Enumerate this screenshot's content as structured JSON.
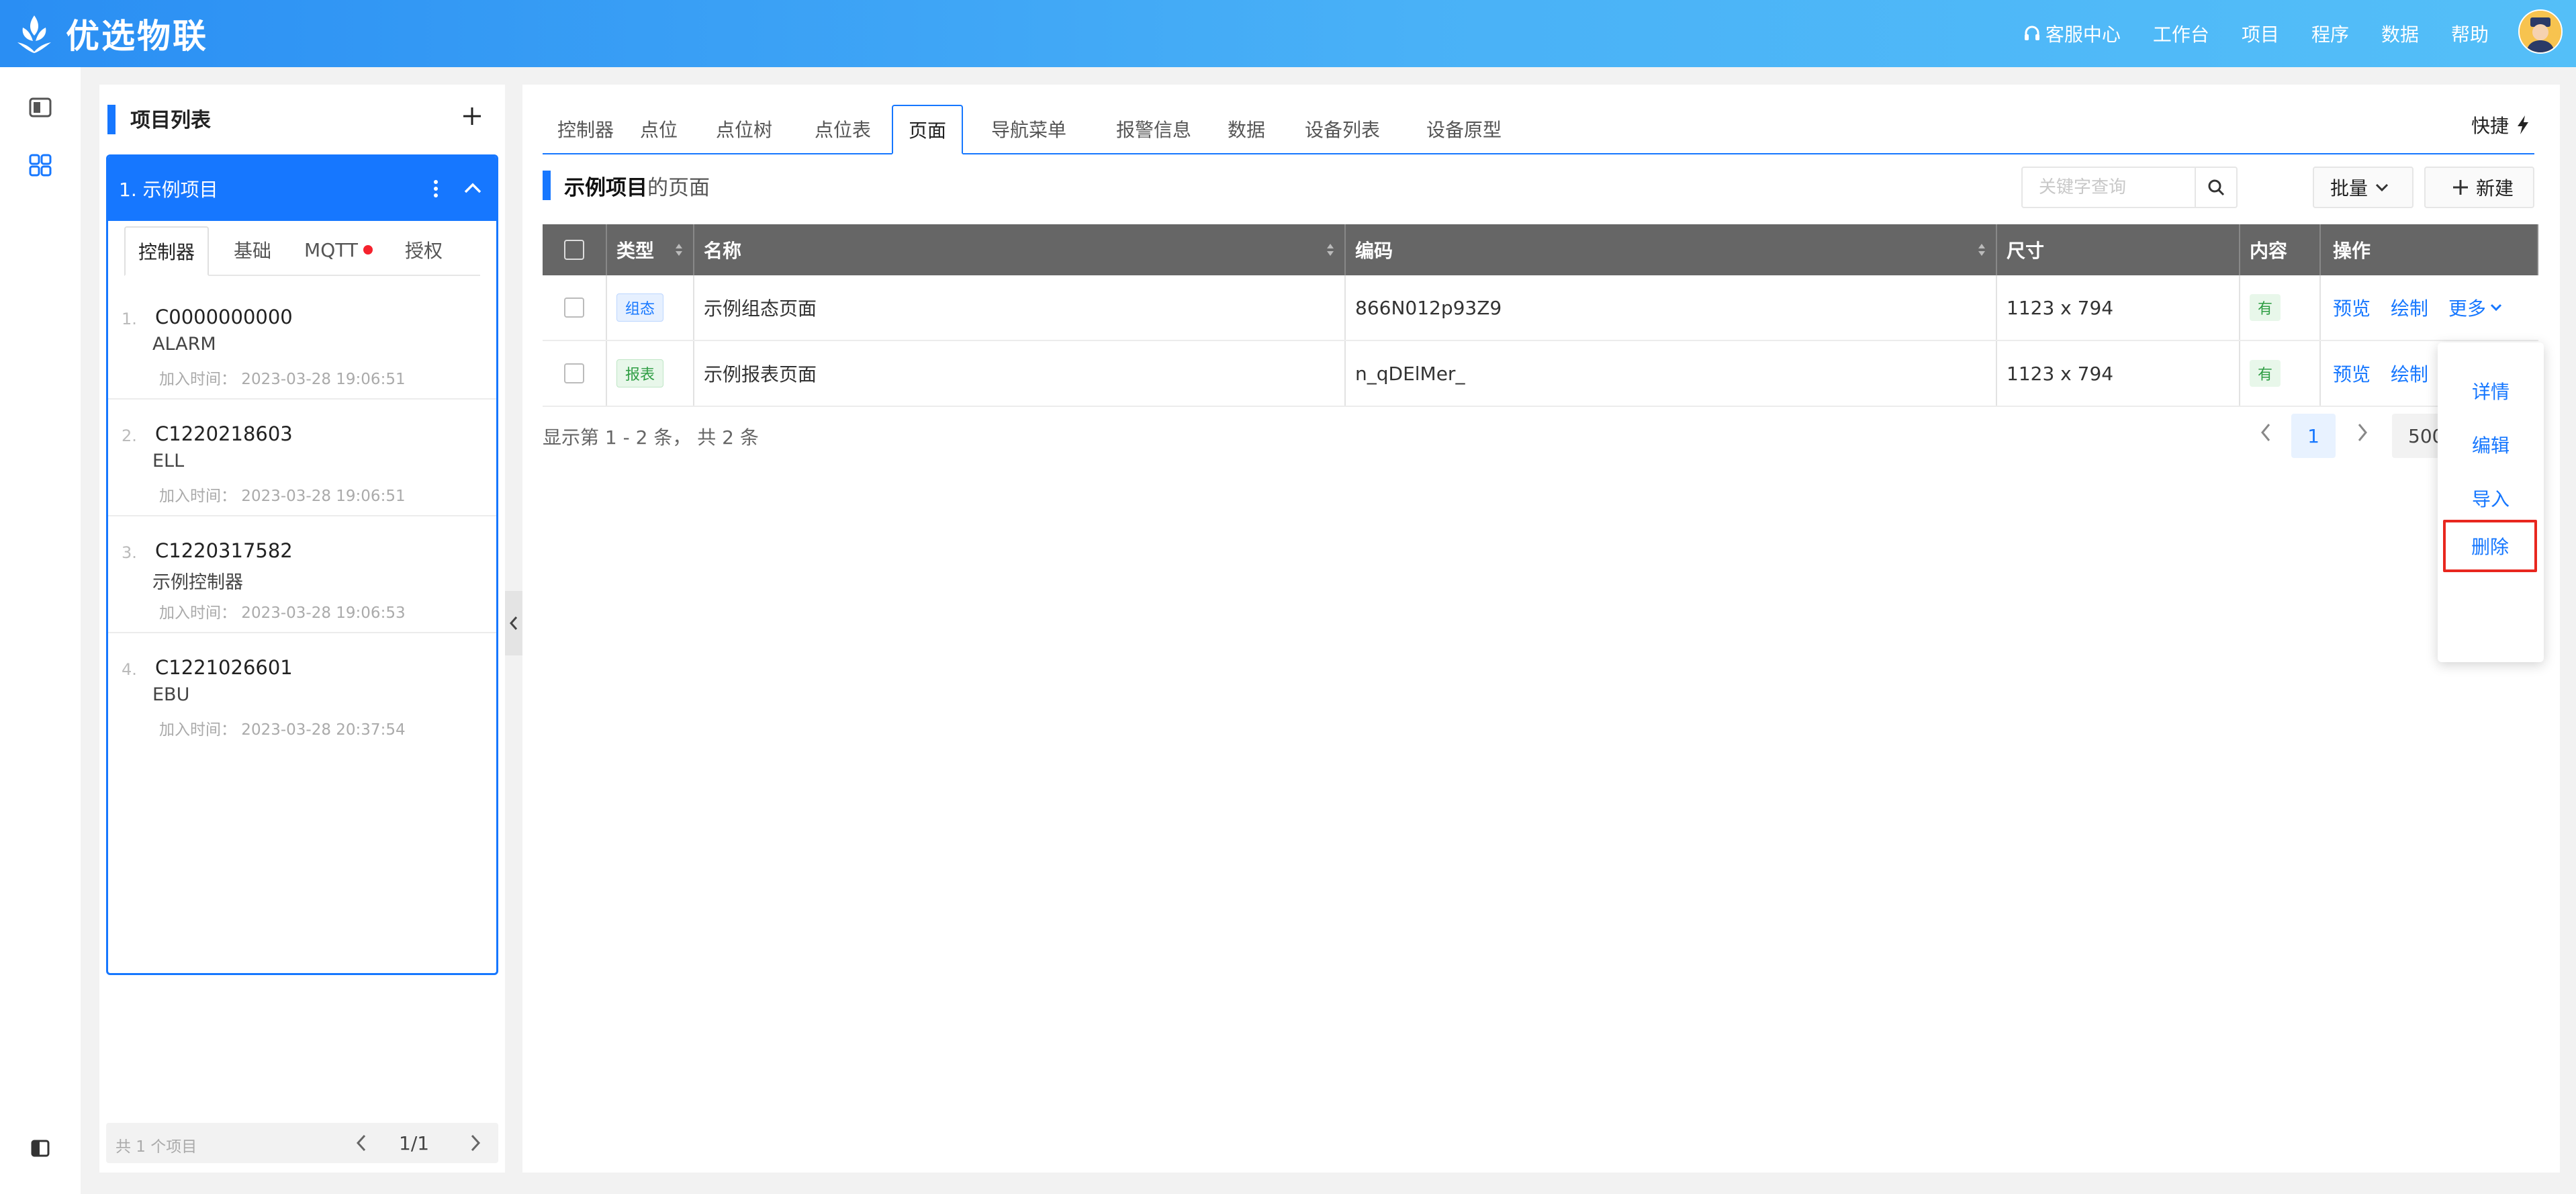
{
  "app": {
    "name": "优选物联"
  },
  "topnav": {
    "service": "客服中心",
    "items": [
      "工作台",
      "项目",
      "程序",
      "数据",
      "帮助"
    ]
  },
  "project_panel": {
    "title": "项目列表",
    "project_name": "1. 示例项目",
    "tabs": [
      "控制器",
      "基础",
      "MQTT",
      "授权"
    ],
    "controllers": [
      {
        "index": "1.",
        "code": "C0000000000",
        "name": "ALARM",
        "time": "加入时间： 2023-03-28 19:06:51"
      },
      {
        "index": "2.",
        "code": "C1220218603",
        "name": "ELL",
        "time": "加入时间： 2023-03-28 19:06:51"
      },
      {
        "index": "3.",
        "code": "C1220317582",
        "name": "示例控制器",
        "time": "加入时间： 2023-03-28 19:06:53"
      },
      {
        "index": "4.",
        "code": "C1221026601",
        "name": "EBU",
        "time": "加入时间： 2023-03-28 20:37:54"
      }
    ],
    "footer": {
      "count": "共 1 个项目",
      "page": "1/1"
    }
  },
  "main": {
    "tabs": [
      "控制器",
      "点位",
      "点位树",
      "点位表",
      "页面",
      "导航菜单",
      "报警信息",
      "数据",
      "设备列表",
      "设备原型"
    ],
    "active_tab": "页面",
    "quick": "快捷",
    "section_title_strong": "示例项目",
    "section_title_rest": "的页面",
    "search_placeholder": "关键字查询",
    "batch": "批量",
    "new": "新建",
    "table": {
      "headers": [
        "类型",
        "名称",
        "编码",
        "尺寸",
        "内容",
        "操作"
      ],
      "rows": [
        {
          "type": "组态",
          "name": "示例组态页面",
          "code": "866N012p93Z9",
          "size": "1123 x 794",
          "content": "有"
        },
        {
          "type": "报表",
          "name": "示例报表页面",
          "code": "n_qDElMer_",
          "size": "1123 x 794",
          "content": "有"
        }
      ],
      "ops": {
        "preview": "预览",
        "draw": "绘制",
        "more": "更多"
      }
    },
    "summary": "显示第 1 - 2 条， 共 2 条",
    "pager": {
      "current": "1",
      "size": "500"
    },
    "more_menu": [
      "详情",
      "编辑",
      "导入",
      "删除"
    ]
  }
}
